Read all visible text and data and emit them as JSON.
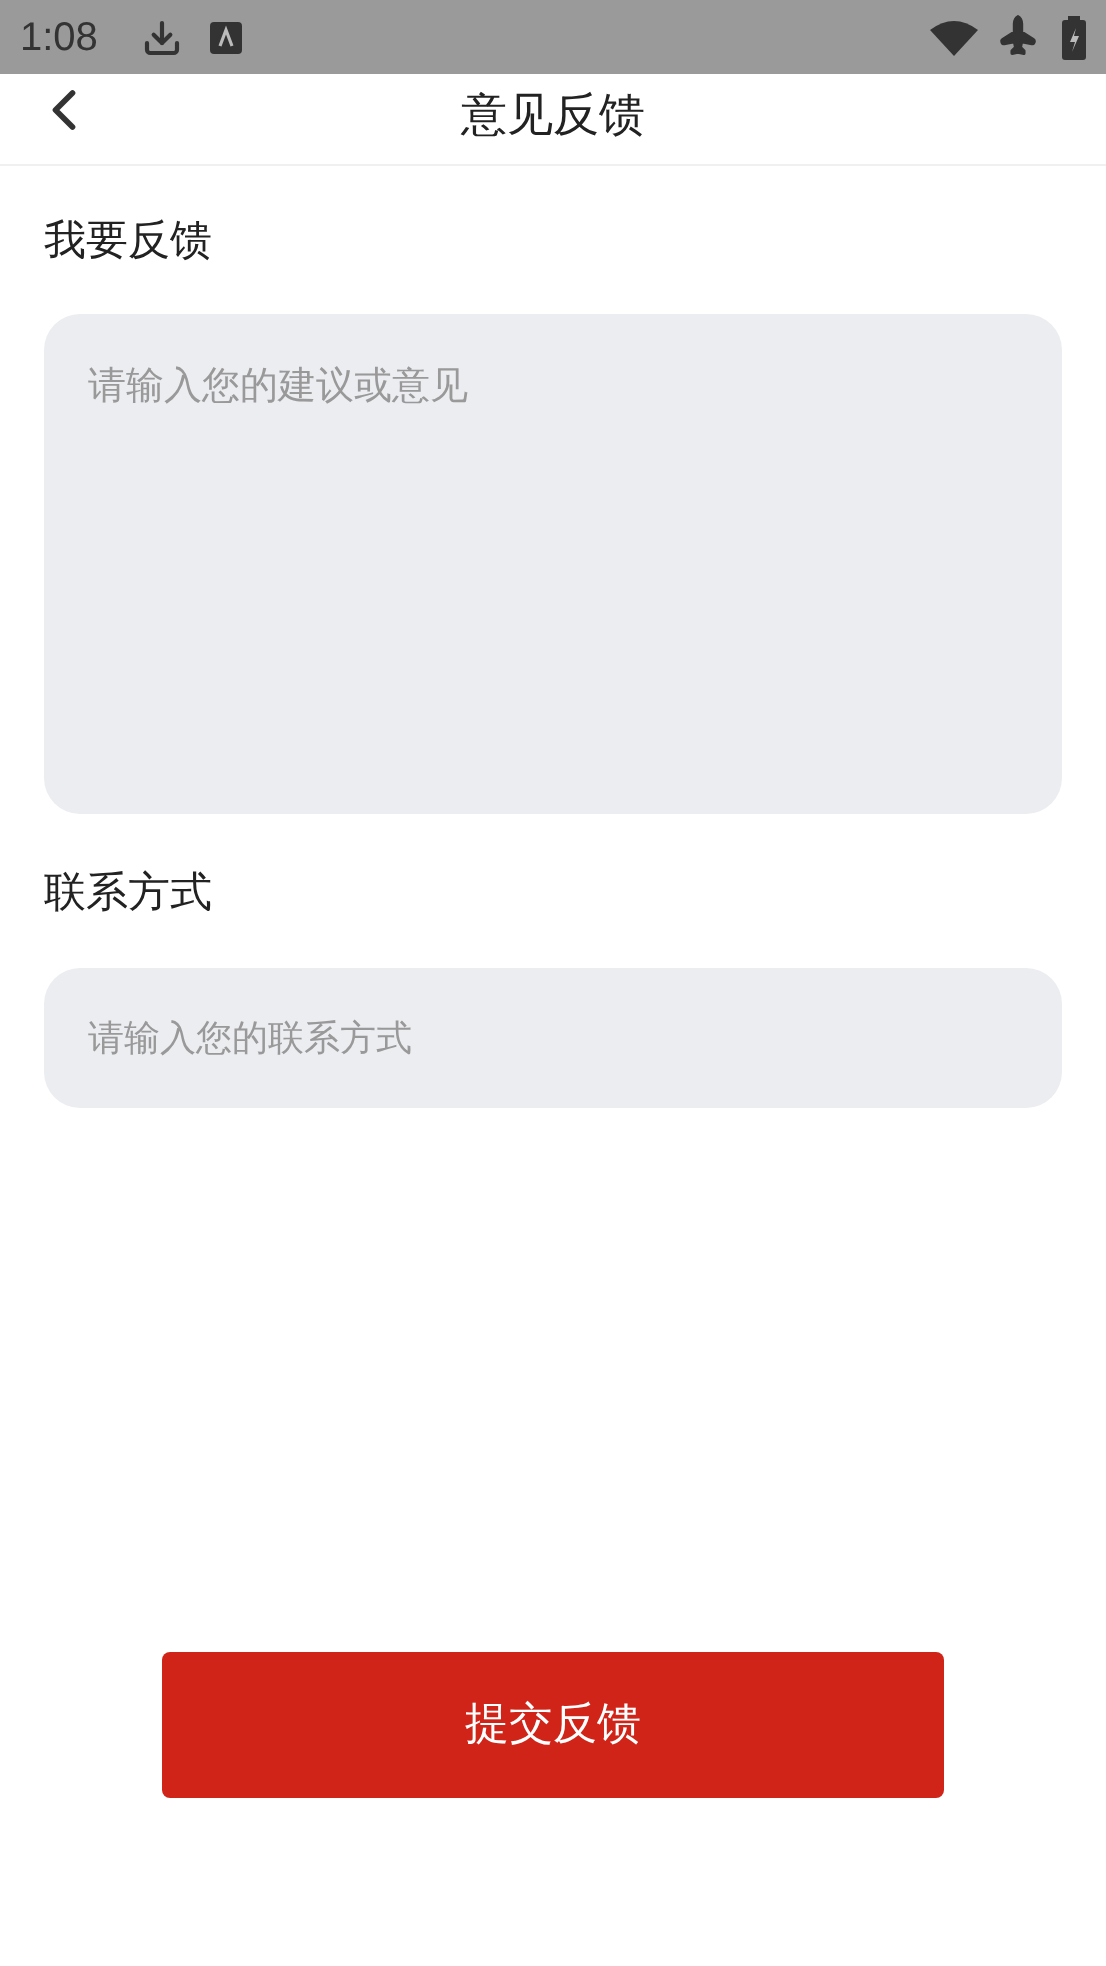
{
  "status_bar": {
    "time": "1:08"
  },
  "header": {
    "title": "意见反馈"
  },
  "feedback": {
    "label": "我要反馈",
    "placeholder": "请输入您的建议或意见"
  },
  "contact": {
    "label": "联系方式",
    "placeholder": "请输入您的联系方式"
  },
  "submit_button": {
    "label": "提交反馈"
  }
}
